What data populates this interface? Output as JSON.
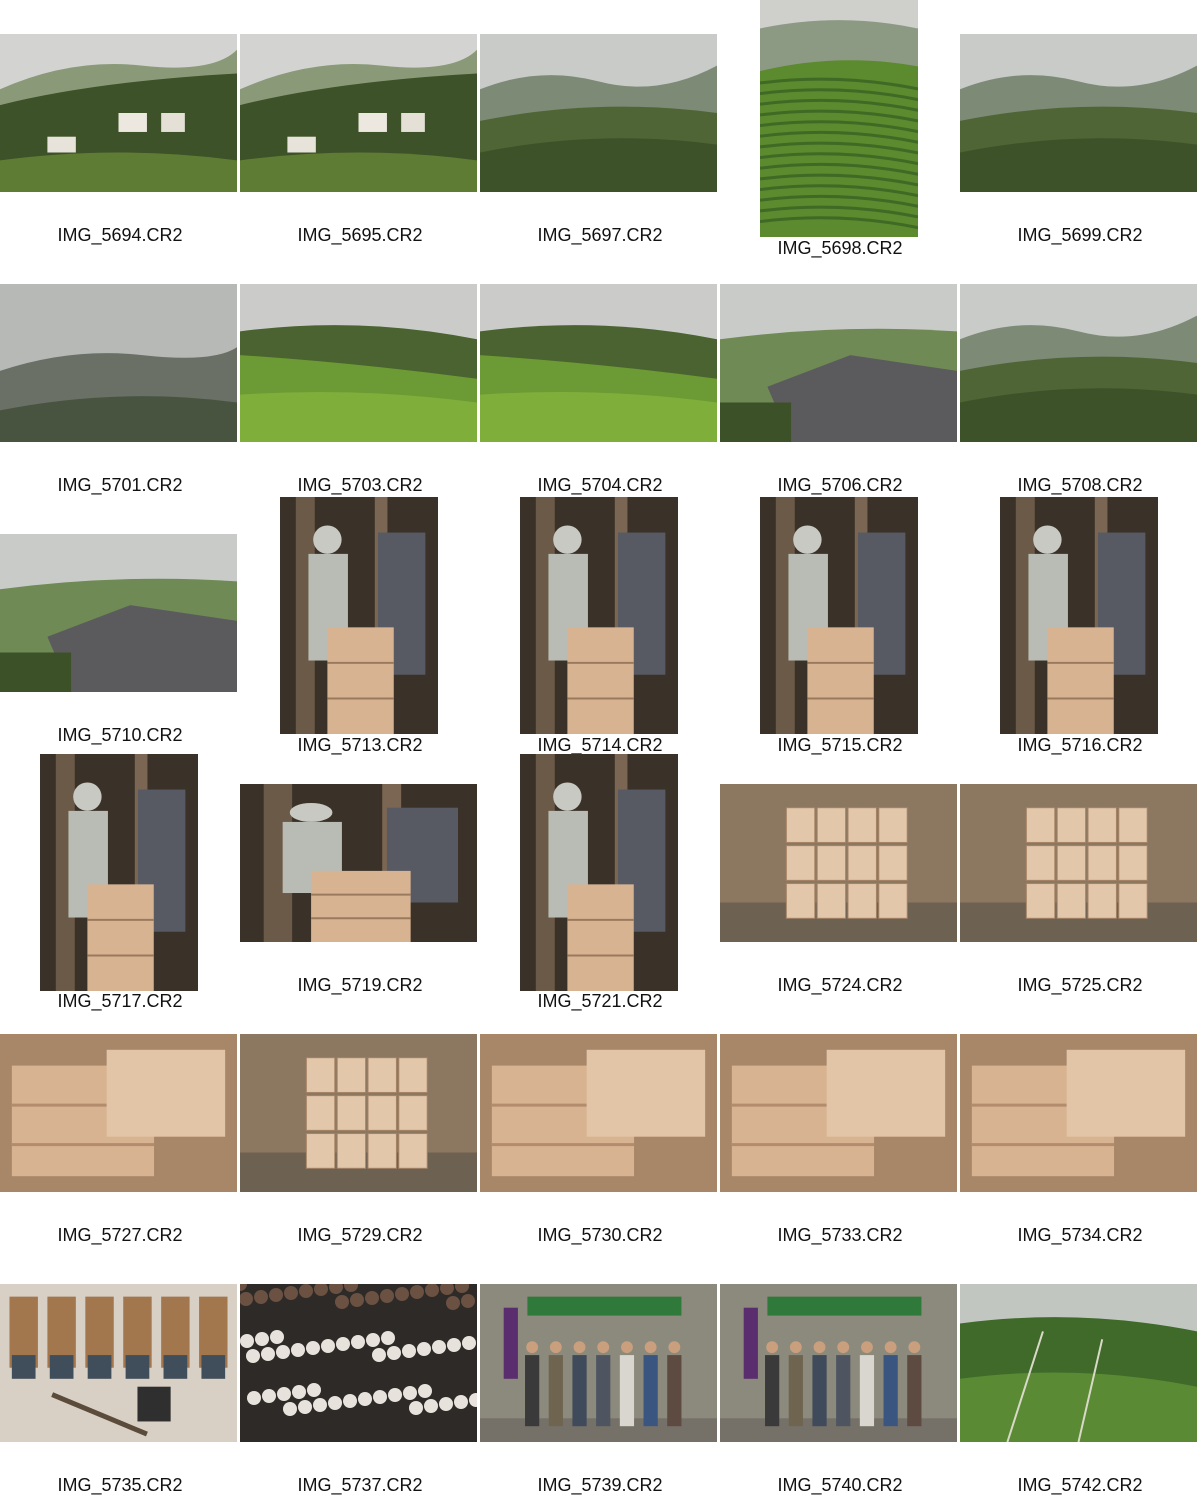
{
  "photos": [
    {
      "filename": "IMG_5694.CR2",
      "scene": "village-landscape"
    },
    {
      "filename": "IMG_5695.CR2",
      "scene": "village-landscape"
    },
    {
      "filename": "IMG_5697.CR2",
      "scene": "misty-hills"
    },
    {
      "filename": "IMG_5698.CR2",
      "scene": "tea-terraces"
    },
    {
      "filename": "IMG_5699.CR2",
      "scene": "misty-hills"
    },
    {
      "filename": "IMG_5701.CR2",
      "scene": "fog-mountains"
    },
    {
      "filename": "IMG_5703.CR2",
      "scene": "tea-bushes"
    },
    {
      "filename": "IMG_5704.CR2",
      "scene": "tea-bushes"
    },
    {
      "filename": "IMG_5706.CR2",
      "scene": "rooftops"
    },
    {
      "filename": "IMG_5708.CR2",
      "scene": "misty-hills"
    },
    {
      "filename": "IMG_5710.CR2",
      "scene": "rooftops"
    },
    {
      "filename": "IMG_5713.CR2",
      "scene": "workshop-people"
    },
    {
      "filename": "IMG_5714.CR2",
      "scene": "workshop-people"
    },
    {
      "filename": "IMG_5715.CR2",
      "scene": "workshop-people"
    },
    {
      "filename": "IMG_5716.CR2",
      "scene": "workshop-people"
    },
    {
      "filename": "IMG_5717.CR2",
      "scene": "workshop-people"
    },
    {
      "filename": "IMG_5719.CR2",
      "scene": "workshop-people"
    },
    {
      "filename": "IMG_5721.CR2",
      "scene": "workshop-people"
    },
    {
      "filename": "IMG_5724.CR2",
      "scene": "wooden-boxes"
    },
    {
      "filename": "IMG_5725.CR2",
      "scene": "wooden-boxes"
    },
    {
      "filename": "IMG_5727.CR2",
      "scene": "wood-closeup"
    },
    {
      "filename": "IMG_5729.CR2",
      "scene": "wooden-boxes"
    },
    {
      "filename": "IMG_5730.CR2",
      "scene": "wood-closeup"
    },
    {
      "filename": "IMG_5733.CR2",
      "scene": "wood-closeup"
    },
    {
      "filename": "IMG_5734.CR2",
      "scene": "wood-closeup"
    },
    {
      "filename": "IMG_5735.CR2",
      "scene": "tools"
    },
    {
      "filename": "IMG_5737.CR2",
      "scene": "figurines"
    },
    {
      "filename": "IMG_5739.CR2",
      "scene": "shop-group"
    },
    {
      "filename": "IMG_5740.CR2",
      "scene": "shop-group"
    },
    {
      "filename": "IMG_5742.CR2",
      "scene": "tea-field-grass"
    }
  ],
  "colors": {
    "sky": "#c9cbc9",
    "forest": "#3d5228",
    "tea_green": "#5c8a2e",
    "wood": "#d8b392",
    "workshop_dark": "#3a3128",
    "roof": "#5b5b5d",
    "caption_text": "#111111"
  }
}
